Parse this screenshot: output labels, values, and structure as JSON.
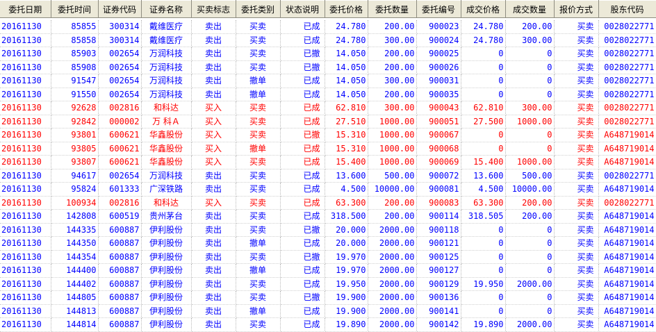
{
  "columns": [
    "委托日期",
    "委托时间",
    "证券代码",
    "证券名称",
    "买卖标志",
    "委托类别",
    "状态说明",
    "委托价格",
    "委托数量",
    "委托编号",
    "成交价格",
    "成交数量",
    "报价方式",
    "股东代码"
  ],
  "colors": {
    "sell": "#0000ff",
    "buy": "#ff0000",
    "header_bg": "#ece9d8"
  },
  "rows": [
    {
      "side": "sell",
      "cells": [
        "20161130",
        "85855",
        "300314",
        "戴维医疗",
        "卖出",
        "买卖",
        "已成",
        "24.780",
        "200.00",
        "900023",
        "24.780",
        "200.00",
        "买卖",
        "0028022771"
      ]
    },
    {
      "side": "sell",
      "cells": [
        "20161130",
        "85858",
        "300314",
        "戴维医疗",
        "卖出",
        "买卖",
        "已成",
        "24.780",
        "300.00",
        "900024",
        "24.780",
        "300.00",
        "买卖",
        "0028022771"
      ]
    },
    {
      "side": "sell",
      "cells": [
        "20161130",
        "85903",
        "002654",
        "万润科技",
        "卖出",
        "买卖",
        "已撤",
        "14.050",
        "200.00",
        "900025",
        "0",
        "0",
        "买卖",
        "0028022771"
      ]
    },
    {
      "side": "sell",
      "cells": [
        "20161130",
        "85908",
        "002654",
        "万润科技",
        "卖出",
        "买卖",
        "已撤",
        "14.050",
        "200.00",
        "900026",
        "0",
        "0",
        "买卖",
        "0028022771"
      ]
    },
    {
      "side": "sell",
      "cells": [
        "20161130",
        "91547",
        "002654",
        "万润科技",
        "卖出",
        "撤单",
        "已成",
        "14.050",
        "300.00",
        "900031",
        "0",
        "0",
        "买卖",
        "0028022771"
      ]
    },
    {
      "side": "sell",
      "cells": [
        "20161130",
        "91550",
        "002654",
        "万润科技",
        "卖出",
        "撤单",
        "已成",
        "14.050",
        "200.00",
        "900035",
        "0",
        "0",
        "买卖",
        "0028022771"
      ]
    },
    {
      "side": "buy",
      "cells": [
        "20161130",
        "92628",
        "002816",
        "和科达",
        "买入",
        "买卖",
        "已成",
        "62.810",
        "300.00",
        "900043",
        "62.810",
        "300.00",
        "买卖",
        "0028022771"
      ]
    },
    {
      "side": "buy",
      "cells": [
        "20161130",
        "92842",
        "000002",
        "万 科Ａ",
        "买入",
        "买卖",
        "已成",
        "27.510",
        "1000.00",
        "900051",
        "27.500",
        "1000.00",
        "买卖",
        "0028022771"
      ]
    },
    {
      "side": "buy",
      "cells": [
        "20161130",
        "93801",
        "600621",
        "华鑫股份",
        "买入",
        "买卖",
        "已撤",
        "15.310",
        "1000.00",
        "900067",
        "0",
        "0",
        "买卖",
        "A648719014"
      ]
    },
    {
      "side": "buy",
      "cells": [
        "20161130",
        "93805",
        "600621",
        "华鑫股份",
        "买入",
        "撤单",
        "已成",
        "15.310",
        "1000.00",
        "900068",
        "0",
        "0",
        "买卖",
        "A648719014"
      ]
    },
    {
      "side": "buy",
      "cells": [
        "20161130",
        "93807",
        "600621",
        "华鑫股份",
        "买入",
        "买卖",
        "已成",
        "15.400",
        "1000.00",
        "900069",
        "15.400",
        "1000.00",
        "买卖",
        "A648719014"
      ]
    },
    {
      "side": "sell",
      "cells": [
        "20161130",
        "94617",
        "002654",
        "万润科技",
        "卖出",
        "买卖",
        "已成",
        "13.600",
        "500.00",
        "900072",
        "13.600",
        "500.00",
        "买卖",
        "0028022771"
      ]
    },
    {
      "side": "sell",
      "cells": [
        "20161130",
        "95824",
        "601333",
        "广深铁路",
        "卖出",
        "买卖",
        "已成",
        "4.500",
        "10000.00",
        "900081",
        "4.500",
        "10000.00",
        "买卖",
        "A648719014"
      ]
    },
    {
      "side": "buy",
      "cells": [
        "20161130",
        "100934",
        "002816",
        "和科达",
        "买入",
        "买卖",
        "已成",
        "63.300",
        "200.00",
        "900083",
        "63.300",
        "200.00",
        "买卖",
        "0028022771"
      ]
    },
    {
      "side": "sell",
      "cells": [
        "20161130",
        "142808",
        "600519",
        "贵州茅台",
        "卖出",
        "买卖",
        "已成",
        "318.500",
        "200.00",
        "900114",
        "318.505",
        "200.00",
        "买卖",
        "A648719014"
      ]
    },
    {
      "side": "sell",
      "cells": [
        "20161130",
        "144335",
        "600887",
        "伊利股份",
        "卖出",
        "买卖",
        "已撤",
        "20.000",
        "2000.00",
        "900118",
        "0",
        "0",
        "买卖",
        "A648719014"
      ]
    },
    {
      "side": "sell",
      "cells": [
        "20161130",
        "144350",
        "600887",
        "伊利股份",
        "卖出",
        "撤单",
        "已成",
        "20.000",
        "2000.00",
        "900121",
        "0",
        "0",
        "买卖",
        "A648719014"
      ]
    },
    {
      "side": "sell",
      "cells": [
        "20161130",
        "144354",
        "600887",
        "伊利股份",
        "卖出",
        "买卖",
        "已撤",
        "19.970",
        "2000.00",
        "900125",
        "0",
        "0",
        "买卖",
        "A648719014"
      ]
    },
    {
      "side": "sell",
      "cells": [
        "20161130",
        "144400",
        "600887",
        "伊利股份",
        "卖出",
        "撤单",
        "已成",
        "19.970",
        "2000.00",
        "900127",
        "0",
        "0",
        "买卖",
        "A648719014"
      ]
    },
    {
      "side": "sell",
      "cells": [
        "20161130",
        "144402",
        "600887",
        "伊利股份",
        "卖出",
        "买卖",
        "已成",
        "19.950",
        "2000.00",
        "900129",
        "19.950",
        "2000.00",
        "买卖",
        "A648719014"
      ]
    },
    {
      "side": "sell",
      "cells": [
        "20161130",
        "144805",
        "600887",
        "伊利股份",
        "卖出",
        "买卖",
        "已撤",
        "19.900",
        "2000.00",
        "900136",
        "0",
        "0",
        "买卖",
        "A648719014"
      ]
    },
    {
      "side": "sell",
      "cells": [
        "20161130",
        "144813",
        "600887",
        "伊利股份",
        "卖出",
        "撤单",
        "已成",
        "19.900",
        "2000.00",
        "900141",
        "0",
        "0",
        "买卖",
        "A648719014"
      ]
    },
    {
      "side": "sell",
      "cells": [
        "20161130",
        "144814",
        "600887",
        "伊利股份",
        "卖出",
        "买卖",
        "已成",
        "19.890",
        "2000.00",
        "900142",
        "19.890",
        "2000.00",
        "买卖",
        "A648719014"
      ]
    }
  ]
}
